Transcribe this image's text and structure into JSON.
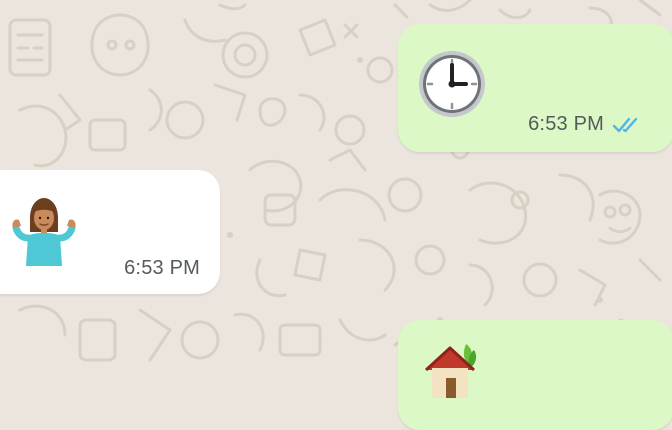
{
  "colors": {
    "wallpaper": "#ece5dd",
    "doodle": "#d6cec3",
    "outgoing_bubble": "#dcf8c6",
    "incoming_bubble": "#ffffff",
    "timestamp": "#555b5a",
    "read_ticks": "#4fb6ec"
  },
  "messages": [
    {
      "direction": "outgoing",
      "content_icon": "clock-emoji",
      "time": "6:53 PM",
      "status": "read",
      "status_icon": "double-check-icon"
    },
    {
      "direction": "incoming",
      "content_icon": "person-shrugging-emoji",
      "time": "6:53 PM"
    },
    {
      "direction": "outgoing",
      "content_icon": "house-with-garden-emoji",
      "time": ""
    }
  ]
}
